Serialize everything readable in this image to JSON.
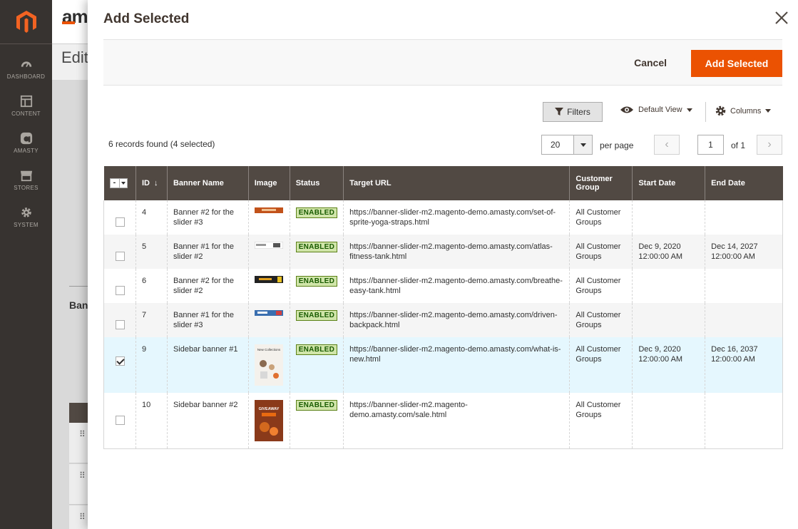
{
  "sidebar": {
    "items": [
      {
        "label": "DASHBOARD",
        "icon": "dashboard-icon"
      },
      {
        "label": "CONTENT",
        "icon": "content-icon"
      },
      {
        "label": "AMASTY",
        "icon": "amasty-icon"
      },
      {
        "label": "STORES",
        "icon": "stores-icon"
      },
      {
        "label": "SYSTEM",
        "icon": "gear-icon"
      }
    ]
  },
  "background": {
    "brand": "am",
    "title": "Edit",
    "section": "Ban"
  },
  "modal": {
    "title": "Add Selected",
    "cancel_label": "Cancel",
    "primary_label": "Add Selected"
  },
  "toolbar": {
    "filters_label": "Filters",
    "view_label": "Default View",
    "columns_label": "Columns",
    "records_found": "6 records found (4 selected)",
    "per_page_value": "20",
    "per_page_label": "per page",
    "page_current": "1",
    "page_of": "of 1"
  },
  "grid": {
    "headers": {
      "id": "ID",
      "banner_name": "Banner Name",
      "image": "Image",
      "status": "Status",
      "target_url": "Target URL",
      "customer_group": "Customer Group",
      "start_date": "Start Date",
      "end_date": "End Date"
    },
    "rows": [
      {
        "checked": false,
        "id": "4",
        "name": "Banner #2 for the slider #3",
        "status": "ENABLED",
        "url": "https://banner-slider-m2.magento-demo.amasty.com/set-of-sprite-yoga-straps.html",
        "group": "All Customer Groups",
        "start": "",
        "end": ""
      },
      {
        "checked": false,
        "id": "5",
        "name": "Banner #1 for the slider #2",
        "status": "ENABLED",
        "url": "https://banner-slider-m2.magento-demo.amasty.com/atlas-fitness-tank.html",
        "group": "All Customer Groups",
        "start": "Dec 9, 2020 12:00:00 AM",
        "end": "Dec 14, 2027 12:00:00 AM"
      },
      {
        "checked": false,
        "id": "6",
        "name": "Banner #2 for the slider #2",
        "status": "ENABLED",
        "url": "https://banner-slider-m2.magento-demo.amasty.com/breathe-easy-tank.html",
        "group": "All Customer Groups",
        "start": "",
        "end": ""
      },
      {
        "checked": false,
        "id": "7",
        "name": "Banner #1 for the slider #3",
        "status": "ENABLED",
        "url": "https://banner-slider-m2.magento-demo.amasty.com/driven-backpack.html",
        "group": "All Customer Groups",
        "start": "",
        "end": ""
      },
      {
        "checked": true,
        "id": "9",
        "name": "Sidebar banner #1",
        "status": "ENABLED",
        "url": "https://banner-slider-m2.magento-demo.amasty.com/what-is-new.html",
        "group": "All Customer Groups",
        "start": "Dec 9, 2020 12:00:00 AM",
        "end": "Dec 16, 2037 12:00:00 AM"
      },
      {
        "checked": false,
        "id": "10",
        "name": "Sidebar banner #2",
        "status": "ENABLED",
        "url": "https://banner-slider-m2.magento-demo.amasty.com/sale.html",
        "group": "All Customer Groups",
        "start": "",
        "end": ""
      }
    ]
  },
  "thumbs": {
    "sidebar1_text": "New Collections",
    "sidebar2_text": "GIVEAWAY"
  },
  "colors": {
    "accent": "#eb5202",
    "header_bg": "#514943",
    "sidebar_bg": "#373330"
  }
}
